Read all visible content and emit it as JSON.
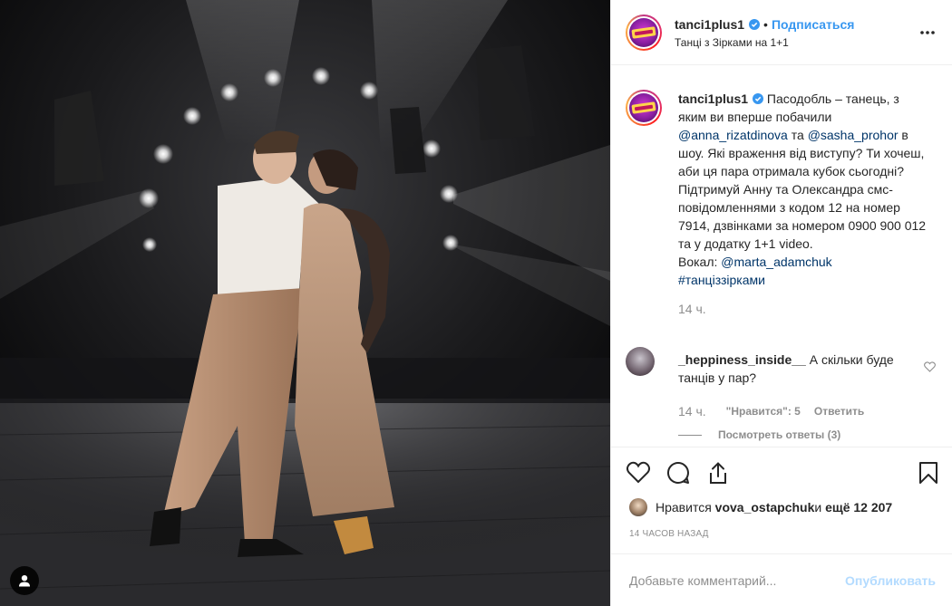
{
  "header": {
    "username": "tanci1plus1",
    "separator": "•",
    "follow_label": "Подписаться",
    "location": "Танці з Зірками на 1+1",
    "more_icon": "ellipsis-icon"
  },
  "caption": {
    "username": "tanci1plus1",
    "text_1": " Пасодобль – танець, з яким ви вперше побачили ",
    "mention_1": "@anna_rizatdinova",
    "text_2": " та ",
    "mention_2": "@sasha_prohor",
    "text_3": " в шоу. Які враження від виступу? Ти хочеш, аби ця пара отримала кубок сьогодні? Підтримуй Анну та Олександра смс-повідомленнями з кодом 12 на номер 7914, дзвінками за номером 0900 900 012 та у додатку 1+1 video.",
    "text_4": "Вокал: ",
    "mention_3": "@marta_adamchuk",
    "hashtag": "#танціззірками",
    "time": "14 ч."
  },
  "comment": {
    "username": "_heppiness_inside__",
    "text": " А скільки буде танців у пар?",
    "time": "14 ч.",
    "likes": "\"Нравится\": 5",
    "reply_label": "Ответить",
    "view_replies": "Посмотреть ответы (3)"
  },
  "actions": {
    "like_icon": "heart-icon",
    "comment_icon": "comment-icon",
    "share_icon": "share-icon",
    "save_icon": "bookmark-icon"
  },
  "likes": {
    "prefix": "Нравится ",
    "user": "vova_ostapchuk",
    "middle": " и ",
    "count": "ещё 12 207"
  },
  "posted_ago": "14 часов назад",
  "add_comment": {
    "placeholder": "Добавьте комментарий...",
    "publish_label": "Опубликовать"
  },
  "colors": {
    "accent": "#3897f0",
    "link": "#003569",
    "muted": "#8e8e8e",
    "publish_disabled": "#b3dbff"
  }
}
